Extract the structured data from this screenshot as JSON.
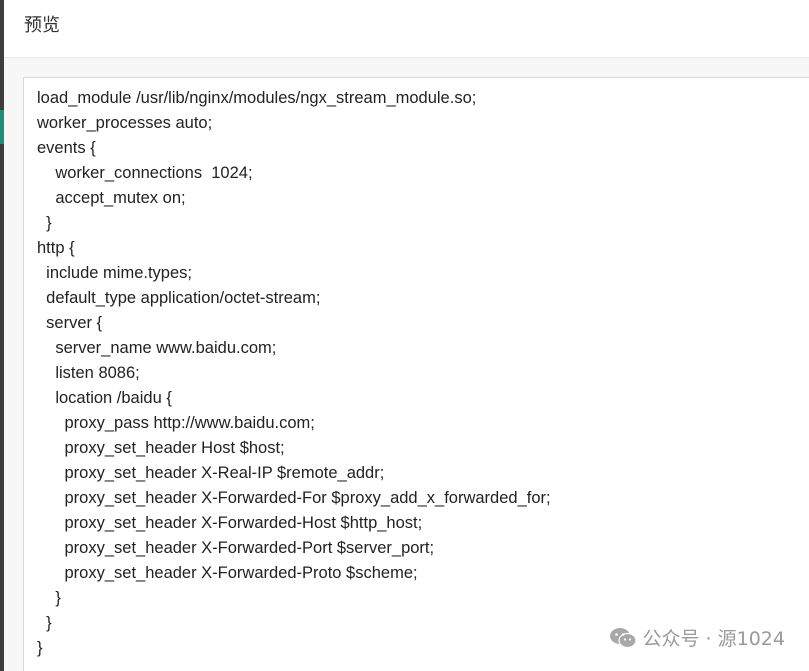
{
  "dialog": {
    "title": "预览"
  },
  "code_lines": [
    "load_module /usr/lib/nginx/modules/ngx_stream_module.so;",
    "worker_processes auto;",
    "events {",
    "    worker_connections  1024;",
    "    accept_mutex on;",
    "  }",
    "http {",
    "  include mime.types;",
    "  default_type application/octet-stream;",
    "  server {",
    "    server_name www.baidu.com;",
    "    listen 8086;",
    "    location /baidu {",
    "      proxy_pass http://www.baidu.com;",
    "      proxy_set_header Host $host;",
    "      proxy_set_header X-Real-IP $remote_addr;",
    "      proxy_set_header X-Forwarded-For $proxy_add_x_forwarded_for;",
    "      proxy_set_header X-Forwarded-Host $http_host;",
    "      proxy_set_header X-Forwarded-Port $server_port;",
    "      proxy_set_header X-Forwarded-Proto $scheme;",
    "    }",
    "  }",
    "}"
  ],
  "watermark": {
    "text": "公众号 · 源1024",
    "icon": "wechat-icon"
  }
}
